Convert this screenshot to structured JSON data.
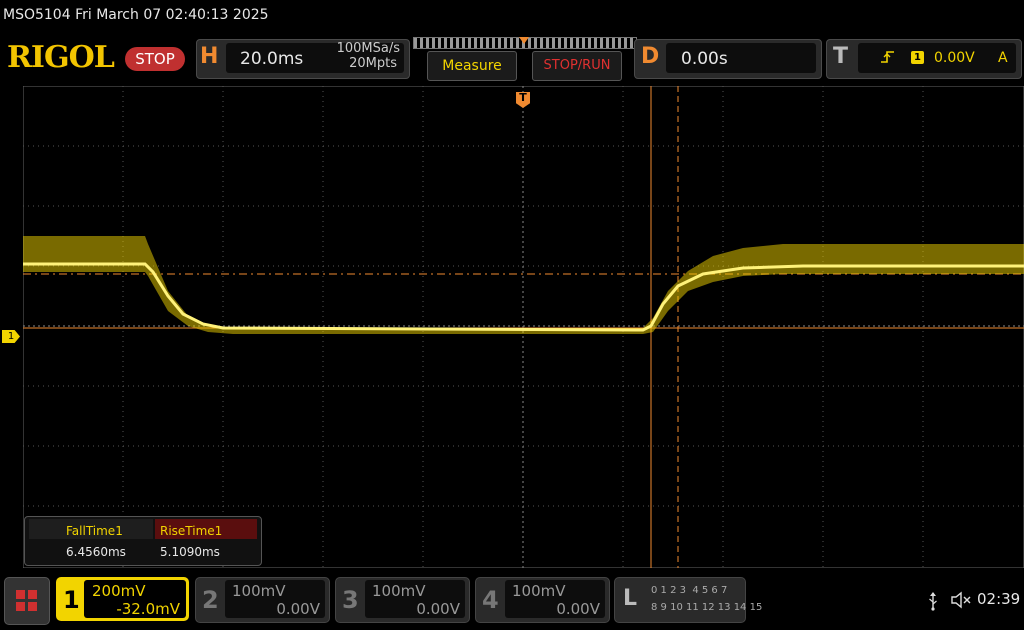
{
  "title_bar": {
    "text": "MSO5104  Fri March 07 02:40:13 2025"
  },
  "logo": {
    "text": "RIGOL"
  },
  "run_state": {
    "label": "STOP"
  },
  "horizontal": {
    "letter": "H",
    "scale": "20.0ms",
    "sample_rate": "100MSa/s",
    "memory_depth": "20Mpts"
  },
  "buttons": {
    "measure": "Measure",
    "stop_run": "STOP/RUN"
  },
  "delay": {
    "letter": "D",
    "value": "0.00s"
  },
  "trigger": {
    "letter": "T",
    "edge_icon": "rising-edge-icon",
    "source": "1",
    "level": "0.00V",
    "mode": "A",
    "position_marker": "T"
  },
  "channel_marker": {
    "label": "1"
  },
  "measurements": [
    {
      "name": "FallTime1",
      "value": "6.4560ms"
    },
    {
      "name": "RiseTime1",
      "value": "5.1090ms"
    }
  ],
  "channels": [
    {
      "number": "1",
      "scale": "200mV",
      "offset": "-32.0mV",
      "active": true,
      "color": "#f2d400"
    },
    {
      "number": "2",
      "scale": "100mV",
      "offset": "0.00V",
      "active": false
    },
    {
      "number": "3",
      "scale": "100mV",
      "offset": "0.00V",
      "active": false
    },
    {
      "number": "4",
      "scale": "100mV",
      "offset": "0.00V",
      "active": false
    }
  ],
  "logic": {
    "letter": "L",
    "row1": "0 1 2 3  4 5 6 7",
    "row2": "8 9 10 11 12 13 14 15"
  },
  "status": {
    "clock": "02:39",
    "usb_icon": "usb-icon",
    "speaker_icon": "speaker-muted-icon"
  },
  "colors": {
    "trace": "#f2d400",
    "cursor": "#f08a30",
    "accent_stop": "#c03030"
  }
}
